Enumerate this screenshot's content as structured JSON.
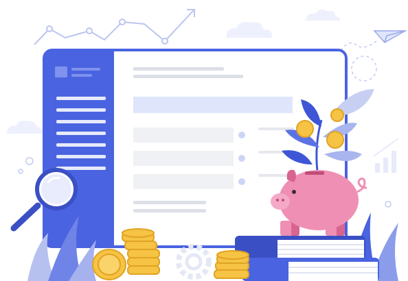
{
  "palette": {
    "blue": "#4a63e0",
    "blue_light": "#dfe5fb",
    "panel_bar": "#f0f1f4",
    "pink": "#ef8fb4",
    "pink_dark": "#d9648f",
    "gold": "#f6c344",
    "gold_dark": "#e0a323",
    "cloud": "#eef1fd",
    "leaf_dark": "#3e56d6",
    "leaf_light": "#a9b5ee"
  },
  "icons": [
    "trend-line-icon",
    "paper-plane-icon",
    "magnifier-icon",
    "piggy-bank-icon",
    "coin-icon",
    "book-icon",
    "gear-icon",
    "bar-chart-icon",
    "cloud-icon",
    "plant-icon"
  ],
  "form": {
    "option_count": 3,
    "sidebar_item_count": 7
  }
}
